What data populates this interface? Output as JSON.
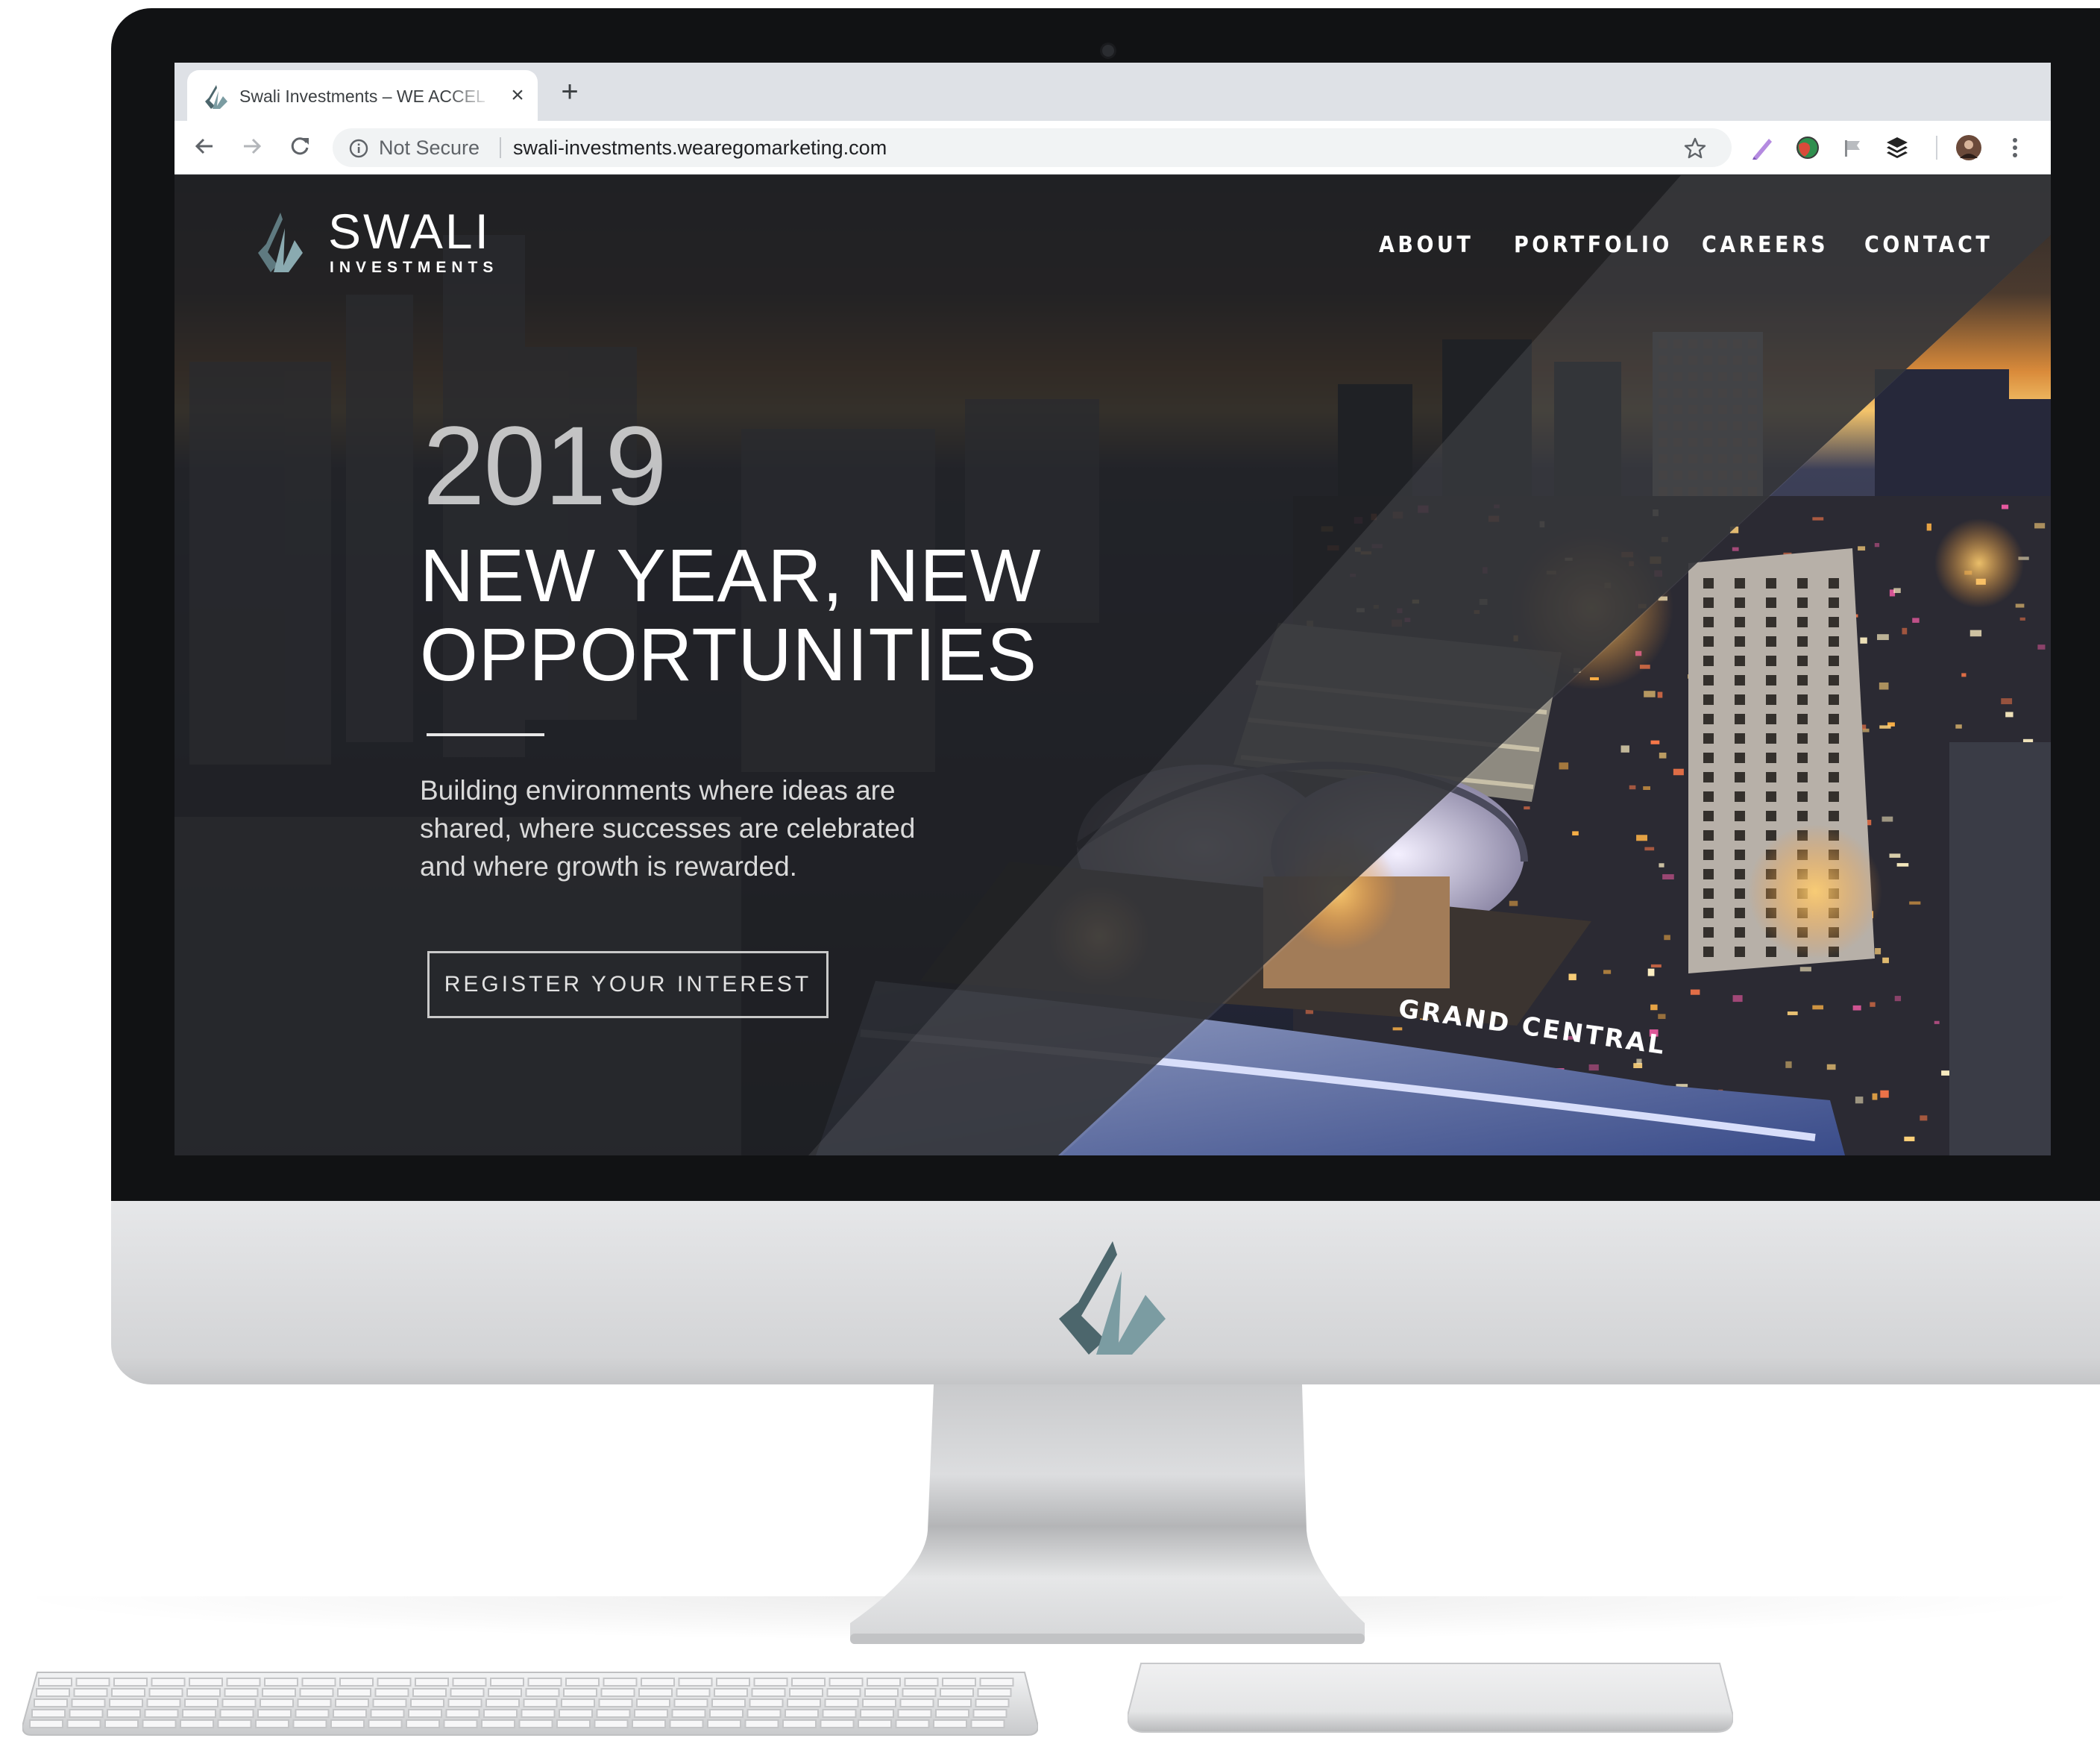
{
  "browser": {
    "tab": {
      "title": "Swali Investments – WE ACCEL",
      "close_icon": "close-icon",
      "favicon": "swali-logo-icon"
    },
    "new_tab_icon": "plus-icon",
    "toolbar": {
      "back_icon": "arrow-left-icon",
      "forward_icon": "arrow-right-icon",
      "reload_icon": "reload-icon",
      "security_label": "Not Secure",
      "url": "swali-investments.wearegomarketing.com",
      "bookmark_icon": "star-icon",
      "extensions": [
        "pen-icon",
        "globe-icon",
        "flag-icon",
        "buffer-icon"
      ],
      "profile_icon": "avatar-icon",
      "menu_icon": "kebab-menu-icon"
    }
  },
  "site": {
    "brand": {
      "name": "SWALI",
      "sub": "INVESTMENTS",
      "logo_colors": [
        "#5f7a80",
        "#7fa1a7"
      ]
    },
    "nav": [
      "ABOUT",
      "PORTFOLIO",
      "CAREERS",
      "CONTACT"
    ],
    "hero": {
      "year": "2019",
      "headline_line1": "NEW YEAR, NEW",
      "headline_line2": "OPPORTUNITIES",
      "body_line1": "Building environments where ideas are",
      "body_line2": "shared, where successes are celebrated",
      "body_line3": "and where growth is rewarded.",
      "cta": "REGISTER YOUR INTEREST",
      "photo_sign_text": "GRAND CENTRAL"
    }
  },
  "colors": {
    "overlay": "#1e1f22",
    "accent": "#6a8a90",
    "text_light": "#ffffff"
  }
}
